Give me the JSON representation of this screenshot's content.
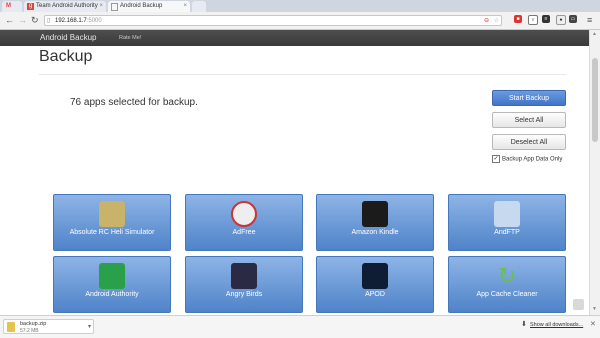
{
  "browser": {
    "tabs": [
      {
        "label": "",
        "icon": "gmail-icon"
      },
      {
        "label": "Team Android Authority",
        "icon": "google-plus-icon"
      },
      {
        "label": "Android Backup",
        "icon": "page-icon"
      }
    ],
    "url_host": "192.168.1.7",
    "url_port": ":5000"
  },
  "header": {
    "brand": "Android Backup",
    "rate": "Rate Me!"
  },
  "page": {
    "title": "Backup",
    "selected_text": "76 apps selected for backup."
  },
  "actions": {
    "start": "Start Backup",
    "select_all": "Select All",
    "deselect_all": "Deselect All",
    "checkbox_label": "Backup App Data Only",
    "checkbox_checked": true
  },
  "apps": [
    {
      "name": "Absolute RC Heli Simulator",
      "icon": "helicopter-icon",
      "color": "#c9b36a"
    },
    {
      "name": "AdFree",
      "icon": "adfree-icon",
      "color": "#e8e8e8"
    },
    {
      "name": "Amazon Kindle",
      "icon": "kindle-icon",
      "color": "#1b1b1b"
    },
    {
      "name": "AndFTP",
      "icon": "ftp-icon",
      "color": "#c7d9ef"
    },
    {
      "name": "Android Authority",
      "icon": "android-authority-icon",
      "color": "#2aa04a"
    },
    {
      "name": "Angry Birds",
      "icon": "angry-birds-icon",
      "color": "#2a2a44"
    },
    {
      "name": "APOD",
      "icon": "apod-icon",
      "color": "#0e1d33"
    },
    {
      "name": "App Cache Cleaner",
      "icon": "refresh-icon",
      "color": "#ffffff"
    }
  ],
  "download": {
    "file": "backup.zip",
    "size": "57.2 MB",
    "show_all": "Show all downloads..."
  }
}
